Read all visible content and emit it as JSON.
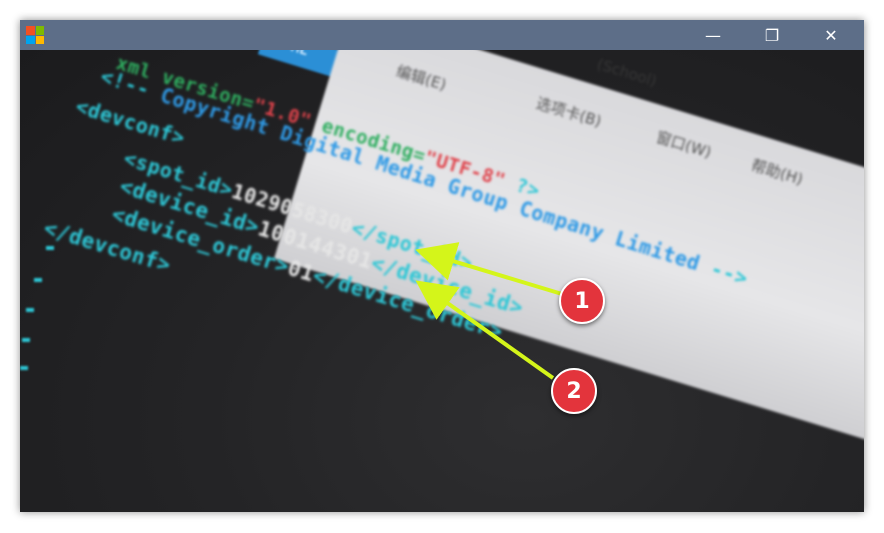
{
  "window": {
    "minimize_glyph": "—",
    "maximize_glyph": "❐",
    "close_glyph": "✕",
    "titlebar_color": "#5d6e88",
    "logo_colors": [
      "#f25022",
      "#7fba00",
      "#00a4ef",
      "#ffb900"
    ]
  },
  "background": {
    "blue_tab_text": "ML",
    "menu_items": [
      "编辑(E)",
      "(School)",
      "选项卡(B)",
      "窗口(W)",
      "帮助(H)"
    ]
  },
  "code": {
    "line1_a": "xml",
    "line1_b": " version",
    "line1_c": "=",
    "line1_d": "\"1.0\"",
    "line1_e": " encoding",
    "line1_f": "=",
    "line1_g": "\"UTF-8\"",
    "line1_h": " ?>",
    "line2": "<!-- Copyright Digital Media Group Company Limited -->",
    "line2_open": "<!--",
    "line2_comment": " Copyright Digital Media Group Company Limited ",
    "line2_close": "-->",
    "line3": "<devconf>",
    "spot_open": "<spot_id>",
    "spot_value": "1029058300",
    "spot_close": "</spot_id>",
    "device_open": "<device_id>",
    "device_value": "100144301",
    "device_close": "</device_id>",
    "order_open": "<device_order>",
    "order_value": "01",
    "order_close": "</device_order>",
    "close_devconf": "</devconf>"
  },
  "annotations": {
    "callout_1": "1",
    "callout_2": "2",
    "arrow_color": "#d4f51a",
    "callout_color": "#e3343c"
  }
}
